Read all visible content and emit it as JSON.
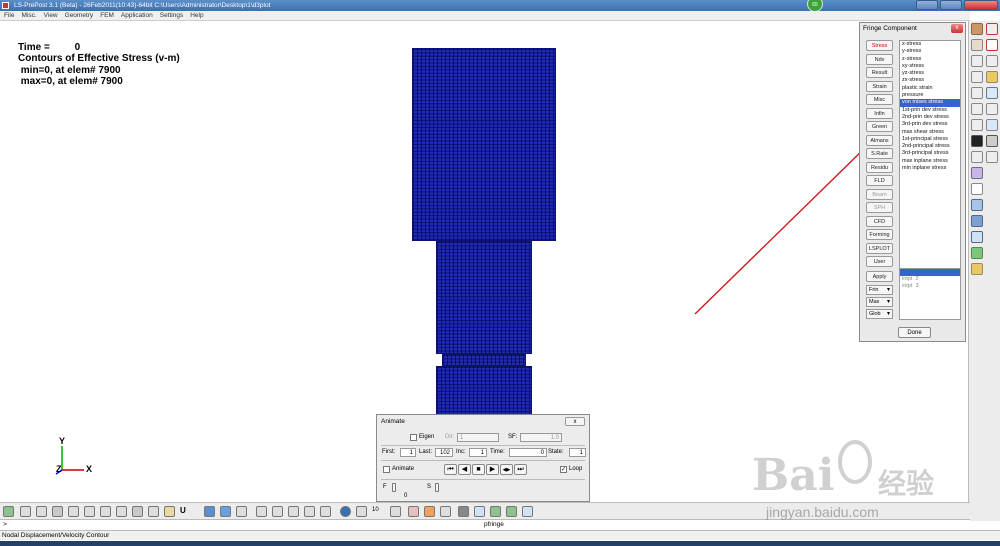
{
  "window": {
    "title": "LS-PrePost 3.1 (Beta) - 26Feb2011(10:43)-64bit C:\\Users\\Administrator\\Desktop\\1\\d3plot",
    "badge": "65"
  },
  "menu": [
    "File",
    "Misc.",
    "View",
    "Geometry",
    "FEM",
    "Application",
    "Settings",
    "Help"
  ],
  "viewport": {
    "time_label": "Time =",
    "time_value": "0",
    "contour_title": "Contours of Effective Stress (v-m)",
    "min_line": " min=0, at elem# 7900",
    "max_line": " max=0, at elem# 7900",
    "axes": {
      "y": "Y",
      "z": "Z",
      "x": "X"
    }
  },
  "fringe": {
    "title": "Fringe Component",
    "close": "x",
    "buttons": [
      "Stress",
      "Ndv",
      "Result",
      "Strain",
      "Misc",
      "Infin",
      "Green",
      "Almans",
      "S.Rate",
      "Residu",
      "FLD",
      "Beam",
      "SPH",
      "CFD",
      "Forming",
      "LSPLOT",
      "User"
    ],
    "active_button": "Stress",
    "disabled_buttons": [
      "Beam",
      "SPH"
    ],
    "apply": "Apply",
    "selects": [
      "Frin",
      "Max",
      "Glob"
    ],
    "components": [
      "x-stress",
      "y-stress",
      "z-stress",
      "xy-stress",
      "yz-stress",
      "zx-stress",
      "plastic strain",
      "pressure",
      "von mises stress",
      "1st-prin dev stress",
      "2nd-prin dev stress",
      "3rd-prin dev stress",
      "max shear stress",
      "1st-principal stress",
      "2nd-principal stress",
      "3rd-principal stress",
      "max inplane stress",
      "min inplane stress"
    ],
    "selected_component": "von mises stress",
    "int_points": [
      "",
      "intpt  2",
      "intpt  3"
    ],
    "done": "Done"
  },
  "animate": {
    "title": "Animate",
    "close": "x",
    "eigen_label": "Eigen",
    "dir_label": "Dir:",
    "dir_value": "1",
    "sf_label": "SF:",
    "sf_value": "1.0",
    "first_label": "First:",
    "first_value": "1",
    "last_label": "Last:",
    "last_value": "102",
    "inc_label": "Inc:",
    "inc_value": "1",
    "time_label": "Time:",
    "time_value": "0",
    "state_label": "State:",
    "state_value": "1",
    "animate_label": "Animate",
    "loop_label": "Loop",
    "loop_checked": "✓",
    "f_label": "F",
    "f_value": "0",
    "s_label": "S",
    "controls": [
      "⏮",
      "◀",
      "■",
      "▶",
      "◀▶",
      "⏭"
    ]
  },
  "bottom_toolbar": {
    "u_label": "U",
    "zoom_value": "10"
  },
  "command": {
    "prompt": ">",
    "text": "pfringe"
  },
  "status": {
    "text": "Nodal Displacement/Velocity Contour"
  },
  "watermark": {
    "brand": "Bai",
    "cn": "经验",
    "url": "jingyan.baidu.com"
  }
}
